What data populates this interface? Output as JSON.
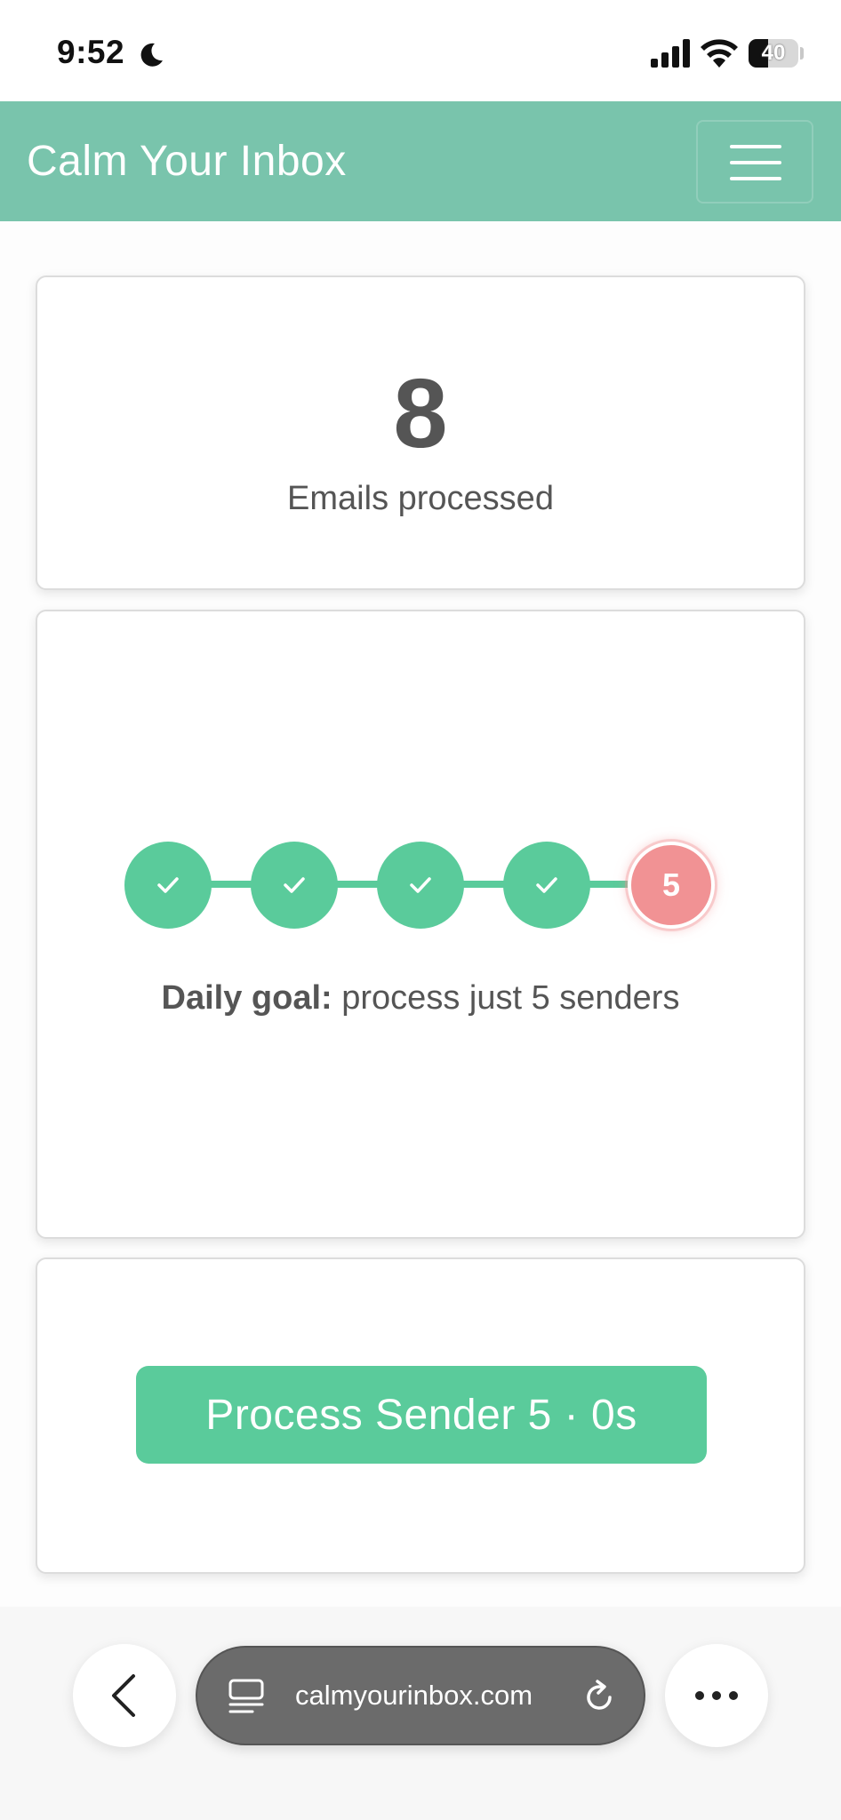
{
  "status_bar": {
    "time": "9:52",
    "battery_level": "40"
  },
  "navbar": {
    "brand": "Calm Your Inbox"
  },
  "stats": {
    "count": "8",
    "label": "Emails processed"
  },
  "goal": {
    "steps": [
      {
        "state": "done"
      },
      {
        "state": "done"
      },
      {
        "state": "done"
      },
      {
        "state": "done"
      },
      {
        "state": "current",
        "label": "5"
      }
    ],
    "label_bold": "Daily goal:",
    "label_text": " process just 5 senders"
  },
  "action": {
    "button_label": "Process Sender 5 · 0s"
  },
  "browser": {
    "url": "calmyourinbox.com"
  },
  "colors": {
    "navbar": "#79c4ac",
    "accent_green": "#5acb9b",
    "current_step": "#f19294"
  }
}
